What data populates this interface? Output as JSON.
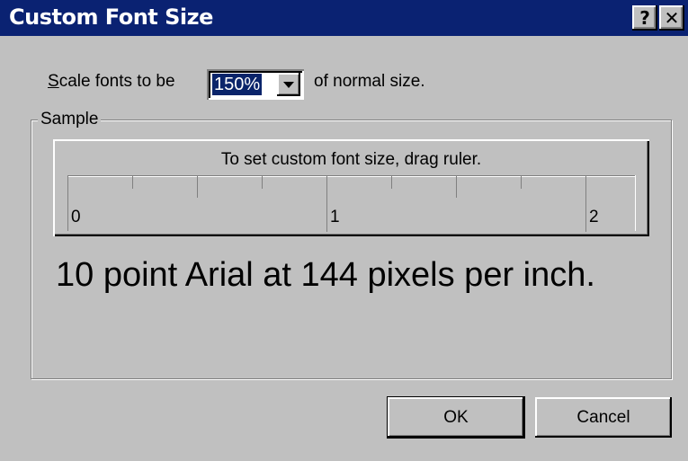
{
  "window": {
    "title": "Custom Font Size"
  },
  "title_buttons": {
    "help": "?",
    "close": "✕"
  },
  "scale": {
    "label_prefix_underlined": "S",
    "label_prefix_rest": "cale fonts to be",
    "value": "150%",
    "label_suffix": "of normal size."
  },
  "sample": {
    "group_label": "Sample",
    "ruler_caption": "To set custom font size, drag ruler.",
    "ruler_labels": [
      "0",
      "1",
      "2"
    ],
    "sample_text": "10 point Arial at 144 pixels per inch."
  },
  "buttons": {
    "ok": "OK",
    "cancel": "Cancel"
  },
  "icons": {
    "dropdown": "chevron-down-icon",
    "help": "help-icon",
    "close": "close-icon"
  }
}
